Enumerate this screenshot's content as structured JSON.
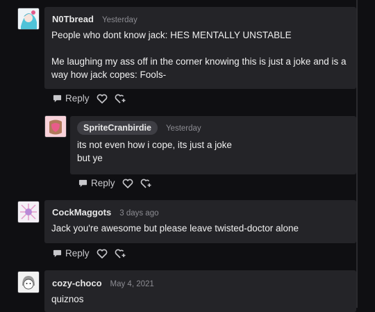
{
  "comments": [
    {
      "author": "N0Tbread",
      "date": "Yesterday",
      "line1": "People who dont know jack: HES MENTALLY UNSTABLE",
      "line2": "Me laughing my ass off in the corner knowing this is just a joke and is a way how jack copes: Fools-",
      "reply_label": "Reply"
    },
    {
      "author": "SpriteCranbirdie",
      "date": "Yesterday",
      "line1": "its not even how i cope, its just a joke",
      "line2": "but ye",
      "reply_label": "Reply"
    },
    {
      "author": "CockMaggots",
      "date": "3 days ago",
      "line1": "Jack you're awesome but please leave twisted-doctor alone",
      "reply_label": "Reply"
    },
    {
      "author": "cozy-choco",
      "date": "May 4, 2021",
      "line1": "quiznos"
    }
  ],
  "icons": {
    "reply": "speech-bubble-icon",
    "like": "heart-icon",
    "reblog": "heart-plus-icon"
  }
}
